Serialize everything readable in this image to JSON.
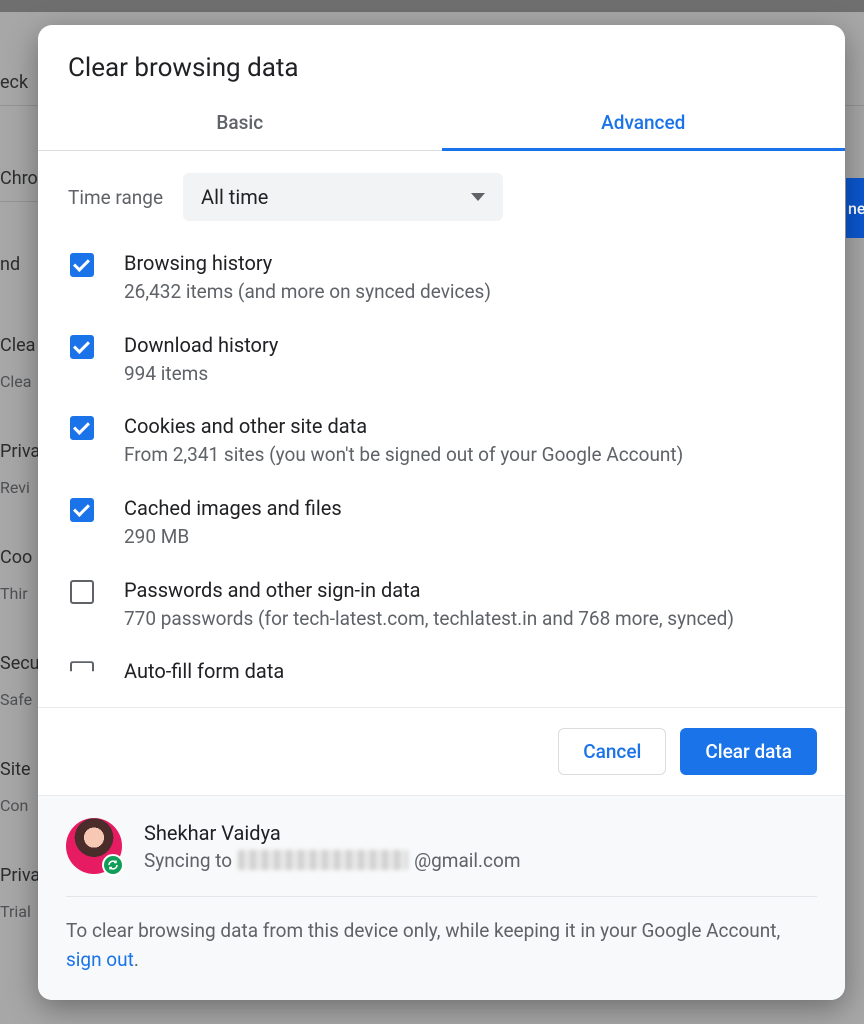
{
  "dialog": {
    "title": "Clear browsing data",
    "tabs": {
      "basic": "Basic",
      "advanced": "Advanced"
    },
    "time_label": "Time range",
    "time_value": "All time",
    "items": [
      {
        "title": "Browsing history",
        "sub": "26,432 items (and more on synced devices)",
        "checked": true
      },
      {
        "title": "Download history",
        "sub": "994 items",
        "checked": true
      },
      {
        "title": "Cookies and other site data",
        "sub": "From 2,341 sites (you won't be signed out of your Google Account)",
        "checked": true
      },
      {
        "title": "Cached images and files",
        "sub": "290 MB",
        "checked": true
      },
      {
        "title": "Passwords and other sign-in data",
        "sub": "770 passwords (for tech-latest.com, techlatest.in and 768 more, synced)",
        "checked": false
      },
      {
        "title": "Auto-fill form data",
        "sub": "",
        "checked": false
      }
    ],
    "cancel": "Cancel",
    "clear": "Clear data"
  },
  "account": {
    "name": "Shekhar Vaidya",
    "sync_prefix": "Syncing to ",
    "sync_suffix": "@gmail.com",
    "note_pre": "To clear browsing data from this device only, while keeping it in your Google Account, ",
    "note_link": "sign out",
    "note_post": "."
  },
  "bg": {
    "row0": "eck",
    "row1": "Chro",
    "row2a": "nd",
    "row3a": "Clea",
    "row3b": "Clea",
    "row4a": "Priva",
    "row4b": "Revi",
    "row5a": "Coo",
    "row5b": "Thir",
    "row6a": "Secu",
    "row6b": "Safe",
    "row7a": "Site",
    "row7b": "Con",
    "row8a": "Priva",
    "row8b": "Trial"
  }
}
